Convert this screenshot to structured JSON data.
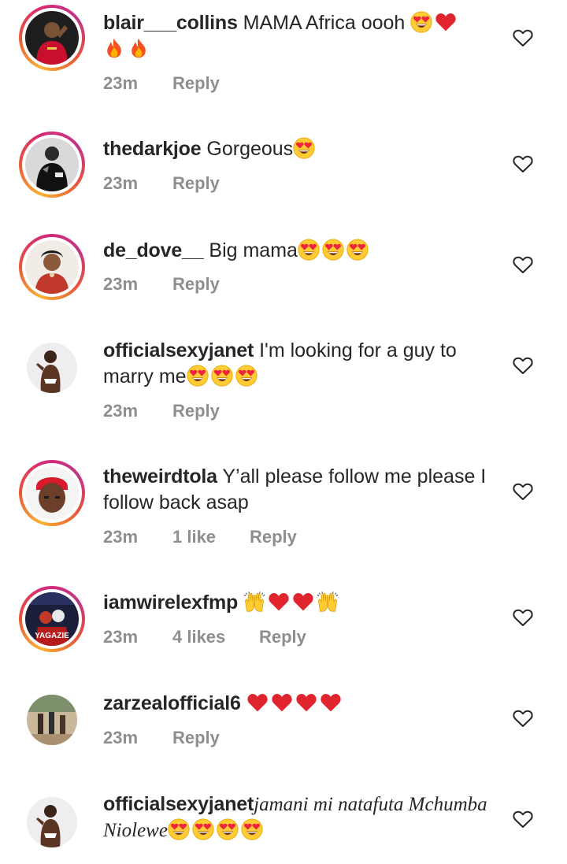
{
  "comments": [
    {
      "username": "blair___collins",
      "text": "MAMA Africa oooh",
      "emojis": [
        "heart-eyes",
        "red-heart",
        "fire",
        "fire"
      ],
      "time": "23m",
      "likes": "",
      "reply_label": "Reply"
    },
    {
      "username": "thedarkjoe",
      "text": "Gorgeous",
      "emojis": [
        "heart-eyes"
      ],
      "time": "23m",
      "likes": "",
      "reply_label": "Reply"
    },
    {
      "username": "de_dove__",
      "text": "Big mama",
      "emojis": [
        "heart-eyes",
        "heart-eyes",
        "heart-eyes"
      ],
      "time": "23m",
      "likes": "",
      "reply_label": "Reply"
    },
    {
      "username": "officialsexyjanet",
      "text": "I'm looking for a guy to marry me",
      "emojis": [
        "heart-eyes",
        "heart-eyes",
        "heart-eyes"
      ],
      "time": "23m",
      "likes": "",
      "reply_label": "Reply"
    },
    {
      "username": "theweirdtola",
      "text": "Y’all please follow me please I follow back asap",
      "emojis": [],
      "time": "23m",
      "likes": "1 like",
      "reply_label": "Reply"
    },
    {
      "username": "iamwirelexfmp",
      "text": "",
      "emojis": [
        "raising-hands",
        "red-heart",
        "red-heart",
        "raising-hands"
      ],
      "time": "23m",
      "likes": "4 likes",
      "reply_label": "Reply"
    },
    {
      "username": "zarzealofficial6",
      "text": "",
      "emojis": [
        "red-heart",
        "red-heart",
        "red-heart",
        "red-heart"
      ],
      "time": "23m",
      "likes": "",
      "reply_label": "Reply"
    },
    {
      "username": "officialsexyjanet",
      "text": "jamani mi natafuta Mchumba Niolewe",
      "emojis": [
        "heart-eyes",
        "heart-eyes",
        "heart-eyes",
        "heart-eyes"
      ],
      "time": "",
      "likes": "",
      "reply_label": ""
    }
  ],
  "avatar_labels": {
    "iamwirelexfmp": "YAGAZIE"
  },
  "colors": {
    "meta_gray": "#8e8e8e",
    "text": "#262626",
    "heart_red": "#e0252e"
  }
}
